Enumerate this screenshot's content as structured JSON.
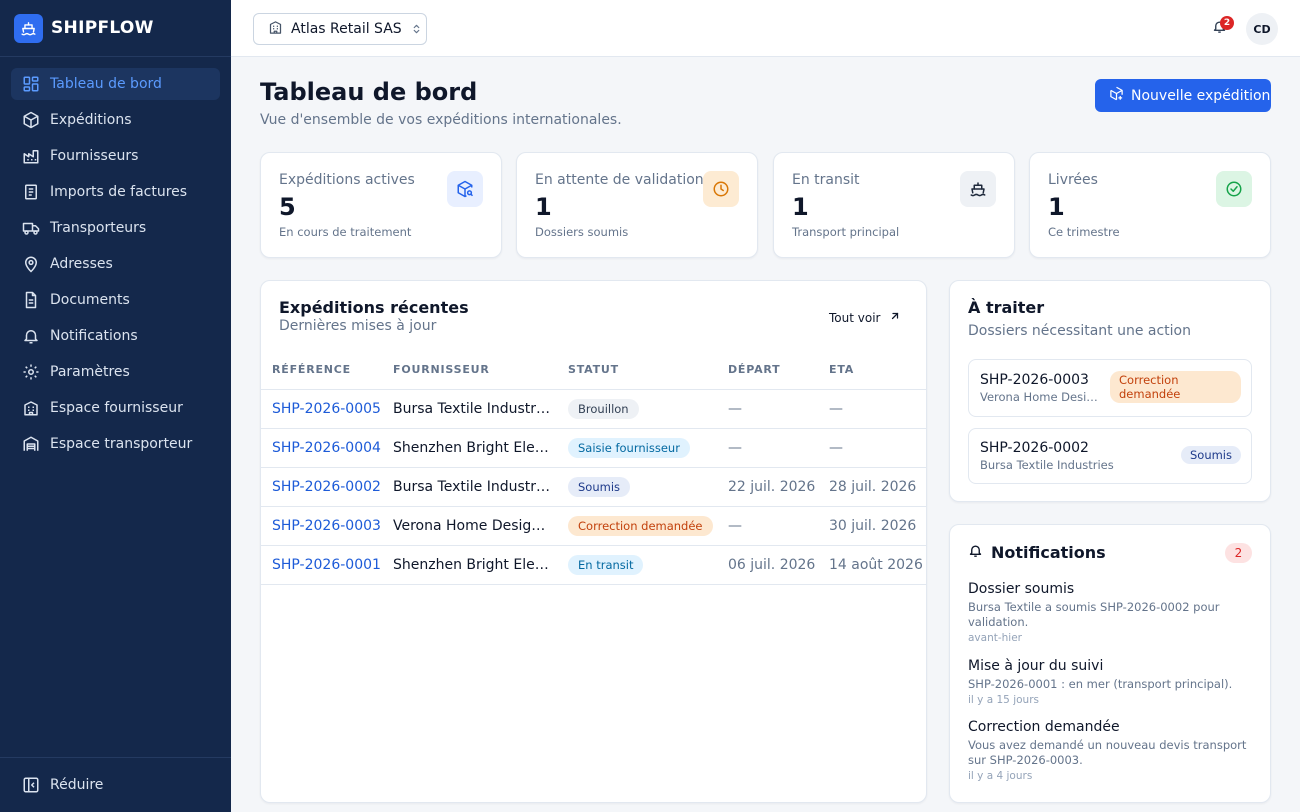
{
  "app": {
    "name": "SHIPFLOW"
  },
  "sidebar": {
    "items": [
      {
        "label": "Tableau de bord",
        "icon": "dashboard-icon",
        "active": true
      },
      {
        "label": "Expéditions",
        "icon": "package-icon"
      },
      {
        "label": "Fournisseurs",
        "icon": "factory-icon"
      },
      {
        "label": "Imports de factures",
        "icon": "invoice-icon"
      },
      {
        "label": "Transporteurs",
        "icon": "truck-icon"
      },
      {
        "label": "Adresses",
        "icon": "map-pin-icon"
      },
      {
        "label": "Documents",
        "icon": "document-icon"
      },
      {
        "label": "Notifications",
        "icon": "bell-icon"
      },
      {
        "label": "Paramètres",
        "icon": "gear-icon"
      },
      {
        "label": "Espace fournisseur",
        "icon": "building-icon"
      },
      {
        "label": "Espace transporteur",
        "icon": "warehouse-icon"
      }
    ],
    "collapse_label": "Réduire"
  },
  "topbar": {
    "organization": "Atlas Retail SAS",
    "notification_count": "2",
    "avatar_initials": "CD"
  },
  "page": {
    "title": "Tableau de bord",
    "subtitle": "Vue d'ensemble de vos expéditions internationales.",
    "new_button": "Nouvelle expédition"
  },
  "stats": [
    {
      "label": "Expéditions actives",
      "value": "5",
      "caption": "En cours de traitement",
      "icon": "package-search-icon",
      "color": "#2563eb",
      "bg": "#e8efff"
    },
    {
      "label": "En attente de validation",
      "value": "1",
      "caption": "Dossiers soumis",
      "icon": "clock-icon",
      "color": "#d97706",
      "bg": "#fdebd3"
    },
    {
      "label": "En transit",
      "value": "1",
      "caption": "Transport principal",
      "icon": "ship-icon",
      "color": "#1e293b",
      "bg": "#eef1f5"
    },
    {
      "label": "Livrées",
      "value": "1",
      "caption": "Ce trimestre",
      "icon": "check-circle-icon",
      "color": "#16a34a",
      "bg": "#dcf5e4"
    }
  ],
  "recent": {
    "title": "Expéditions récentes",
    "subtitle": "Dernières mises à jour",
    "view_all": "Tout voir",
    "columns": [
      "RÉFÉRENCE",
      "FOURNISSEUR",
      "STATUT",
      "DÉPART",
      "ETA"
    ],
    "rows": [
      {
        "ref": "SHP-2026-0005",
        "supplier": "Bursa Textile Industries",
        "status": "Brouillon",
        "status_kind": "draft",
        "departure": "—",
        "eta": "—"
      },
      {
        "ref": "SHP-2026-0004",
        "supplier": "Shenzhen Bright Electronics",
        "status": "Saisie fournisseur",
        "status_kind": "supplier",
        "departure": "—",
        "eta": "—"
      },
      {
        "ref": "SHP-2026-0002",
        "supplier": "Bursa Textile Industries",
        "status": "Soumis",
        "status_kind": "submitted",
        "departure": "22 juil. 2026",
        "eta": "28 juil. 2026"
      },
      {
        "ref": "SHP-2026-0003",
        "supplier": "Verona Home Design srl",
        "status": "Correction demandée",
        "status_kind": "correction",
        "departure": "—",
        "eta": "30 juil. 2026"
      },
      {
        "ref": "SHP-2026-0001",
        "supplier": "Shenzhen Bright Electronics",
        "status": "En transit",
        "status_kind": "transit",
        "departure": "06 juil. 2026",
        "eta": "14 août 2026"
      }
    ]
  },
  "status_colors": {
    "draft": {
      "bg": "#eef1f5",
      "fg": "#334155"
    },
    "supplier": {
      "bg": "#e0f2fe",
      "fg": "#0369a1"
    },
    "submitted": {
      "bg": "#e6ecf8",
      "fg": "#1e3a8a"
    },
    "correction": {
      "bg": "#fde8d0",
      "fg": "#c2410c"
    },
    "transit": {
      "bg": "#e0f2fe",
      "fg": "#0369a1"
    }
  },
  "todo": {
    "title": "À traiter",
    "subtitle": "Dossiers nécessitant une action",
    "items": [
      {
        "ref": "SHP-2026-0003",
        "supplier": "Verona Home Design srl",
        "status": "Correction demandée",
        "status_kind": "correction"
      },
      {
        "ref": "SHP-2026-0002",
        "supplier": "Bursa Textile Industries",
        "status": "Soumis",
        "status_kind": "submitted"
      }
    ]
  },
  "notifications": {
    "title": "Notifications",
    "count": "2",
    "items": [
      {
        "title": "Dossier soumis",
        "body": "Bursa Textile a soumis SHP-2026-0002 pour validation.",
        "time": "avant-hier"
      },
      {
        "title": "Mise à jour du suivi",
        "body": "SHP-2026-0001 : en mer (transport principal).",
        "time": "il y a 15 jours"
      },
      {
        "title": "Correction demandée",
        "body": "Vous avez demandé un nouveau devis transport sur SHP-2026-0003.",
        "time": "il y a 4 jours"
      }
    ]
  }
}
